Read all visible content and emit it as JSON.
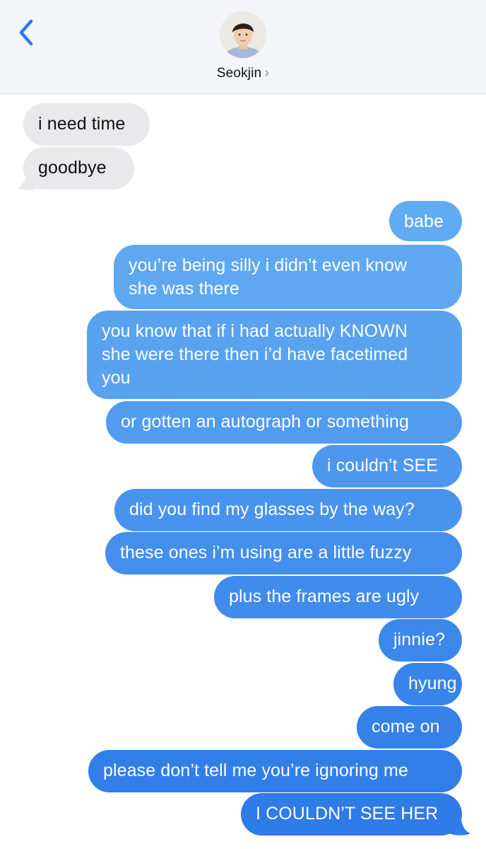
{
  "header": {
    "contact_name": "Seokjin",
    "chevron": "›",
    "back_icon": "chevron-left-icon"
  },
  "colors": {
    "header_bg": "#f4f5f8",
    "incoming_bubble": "#e9e9eb",
    "outgoing_top": "#64adf2",
    "outgoing_bottom": "#2f7ae9",
    "accent": "#2a7ae8"
  },
  "messages": [
    {
      "dir": "in",
      "text": "i need time"
    },
    {
      "dir": "in",
      "text": "goodbye"
    },
    {
      "dir": "out",
      "text": "babe"
    },
    {
      "dir": "out",
      "text": "you’re being silly i didn’t even know\nshe was there"
    },
    {
      "dir": "out",
      "text": "you know that if i had actually KNOWN\nshe were there then i’d have facetimed\nyou"
    },
    {
      "dir": "out",
      "text": "or gotten an autograph or something"
    },
    {
      "dir": "out",
      "text": "i couldn’t SEE"
    },
    {
      "dir": "out",
      "text": "did you find my glasses by the way?"
    },
    {
      "dir": "out",
      "text": "these ones i’m using are a little fuzzy"
    },
    {
      "dir": "out",
      "text": "plus the frames are ugly"
    },
    {
      "dir": "out",
      "text": "jinnie?"
    },
    {
      "dir": "out",
      "text": "hyung"
    },
    {
      "dir": "out",
      "text": "come on"
    },
    {
      "dir": "out",
      "text": "please don’t tell me you’re ignoring me"
    },
    {
      "dir": "out",
      "text": "I COULDN’T SEE HER"
    }
  ]
}
